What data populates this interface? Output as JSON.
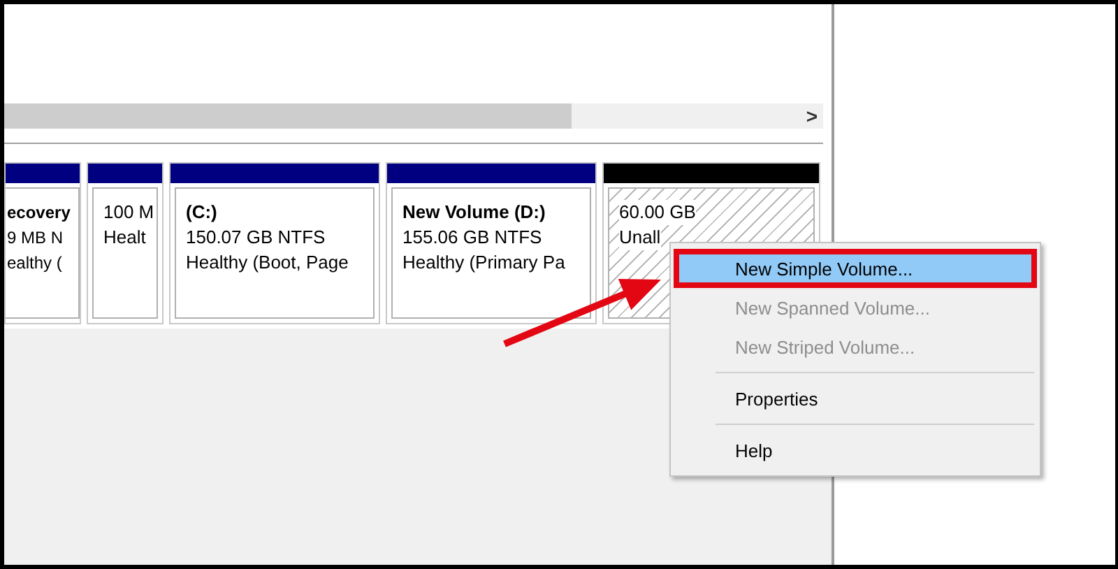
{
  "scrollbar": {
    "arrow": ">"
  },
  "partitions": [
    {
      "color": "#000080",
      "kind": "volume",
      "lines": [
        {
          "text": "ecovery",
          "bold": true
        },
        {
          "text": "9 MB N",
          "bold": false
        },
        {
          "text": "ealthy (",
          "bold": false
        }
      ]
    },
    {
      "color": "#000080",
      "kind": "volume",
      "lines": [
        {
          "text": "100 M",
          "bold": false
        },
        {
          "text": "Healt",
          "bold": false
        }
      ]
    },
    {
      "color": "#000080",
      "kind": "volume",
      "lines": [
        {
          "text": "(C:)",
          "bold": true
        },
        {
          "text": "150.07 GB NTFS",
          "bold": false
        },
        {
          "text": "Healthy (Boot, Page",
          "bold": false
        }
      ]
    },
    {
      "color": "#000080",
      "kind": "volume",
      "lines": [
        {
          "text": "New Volume  (D:)",
          "bold": true
        },
        {
          "text": "155.06 GB NTFS",
          "bold": false
        },
        {
          "text": "Healthy (Primary Pa",
          "bold": false
        }
      ]
    },
    {
      "color": "#000000",
      "kind": "unallocated",
      "lines": [
        {
          "text": "60.00 GB",
          "bold": false
        },
        {
          "text": "Unall",
          "bold": false
        }
      ]
    }
  ],
  "context_menu": [
    {
      "kind": "item",
      "label": "New Simple Volume...",
      "selected": true,
      "disabled": false
    },
    {
      "kind": "item",
      "label": "New Spanned Volume...",
      "selected": false,
      "disabled": true
    },
    {
      "kind": "item",
      "label": "New Striped Volume...",
      "selected": false,
      "disabled": true
    },
    {
      "kind": "separator"
    },
    {
      "kind": "item",
      "label": "Properties",
      "selected": false,
      "disabled": false
    },
    {
      "kind": "separator"
    },
    {
      "kind": "item",
      "label": "Help",
      "selected": false,
      "disabled": false
    }
  ]
}
